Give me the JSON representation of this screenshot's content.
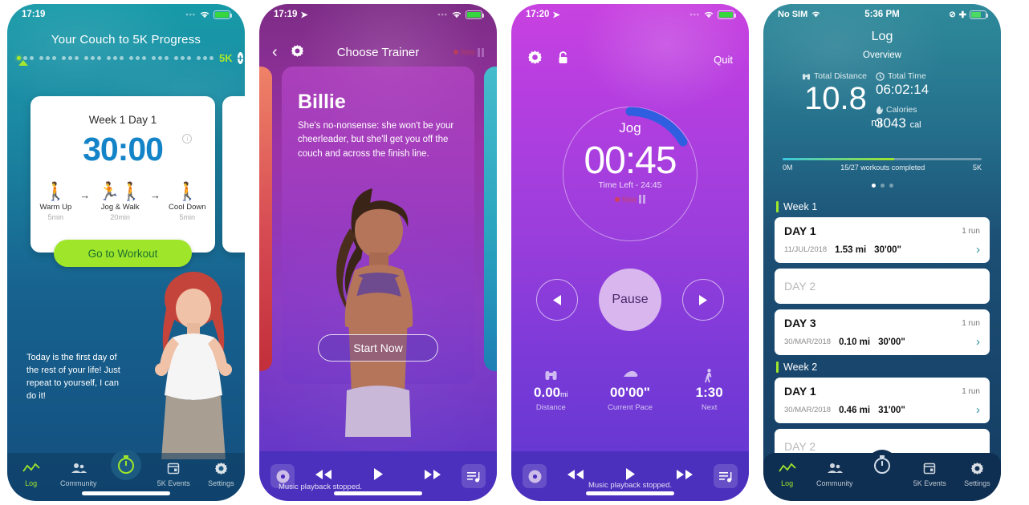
{
  "phone1": {
    "statusbar": {
      "time": "17:19",
      "wifi_icon": "wifi-icon",
      "battery_icon": "battery-charging-icon"
    },
    "title": "Your Couch to 5K Progress",
    "goal_label": "5K",
    "add_button": "+",
    "dot_groups": 9,
    "card": {
      "week_day": "Week 1 Day 1",
      "duration": "30:00",
      "info_icon": "i",
      "steps": [
        {
          "name": "Warm Up",
          "minutes": "5min",
          "icon": "walk-icon"
        },
        {
          "name": "Jog & Walk",
          "minutes": "20min",
          "icon": "run-walk-icon"
        },
        {
          "name": "Cool Down",
          "minutes": "5min",
          "icon": "cooldown-icon"
        }
      ],
      "arrow": "→",
      "cta": "Go to Workout"
    },
    "motivation": "Today is the first day of the rest of your life! Just repeat to yourself, I can do it!",
    "tabs": [
      {
        "label": "Log",
        "icon": "chart-line-icon"
      },
      {
        "label": "Community",
        "icon": "people-icon"
      },
      {
        "label": "",
        "icon": "stopwatch-icon"
      },
      {
        "label": "5K Events",
        "icon": "calendar-icon"
      },
      {
        "label": "Settings",
        "icon": "gear-icon"
      }
    ]
  },
  "phone2": {
    "statusbar": {
      "time": "17:19",
      "location_icon": "location-arrow-icon",
      "wifi_icon": "wifi-icon",
      "battery_icon": "battery-charging-icon"
    },
    "nav": {
      "back_icon": "chevron-left-icon",
      "settings_icon": "gear-icon",
      "title": "Choose Trainer",
      "recording_label": "Now"
    },
    "trainer": {
      "name": "Billie",
      "description": "She's no-nonsense: she won't be your cheerleader, but she'll get you off the couch and across the finish line."
    },
    "start_button": "Start Now",
    "music": {
      "status": "Music playback stopped.",
      "disc_icon": "disc-icon",
      "prev_icon": "rewind-icon",
      "play_icon": "play-icon",
      "next_icon": "fast-forward-icon",
      "playlist_icon": "playlist-icon"
    }
  },
  "phone3": {
    "statusbar": {
      "time": "17:20",
      "location_icon": "location-arrow-icon",
      "wifi_icon": "wifi-icon",
      "battery_icon": "battery-charging-icon"
    },
    "top": {
      "settings_icon": "gear-icon",
      "lock_icon": "lock-icon",
      "quit_label": "Quit"
    },
    "timer": {
      "phase": "Jog",
      "value": "00:45",
      "time_left": "Time Left - 24:45",
      "recording_label": "Now",
      "progress_percent": 28
    },
    "controls": {
      "prev_icon": "previous-icon",
      "pause_label": "Pause",
      "next_icon": "next-icon"
    },
    "stats": [
      {
        "icon": "binoculars-icon",
        "value": "0.00",
        "unit": "mi",
        "label": "Distance"
      },
      {
        "icon": "shoe-icon",
        "value": "00'00\"",
        "unit": "",
        "label": "Current Pace"
      },
      {
        "icon": "walk-icon",
        "value": "1:30",
        "unit": "",
        "label": "Next"
      }
    ],
    "music": {
      "status": "Music playback stopped.",
      "disc_icon": "disc-icon",
      "prev_icon": "rewind-icon",
      "play_icon": "play-icon",
      "next_icon": "fast-forward-icon",
      "playlist_icon": "playlist-icon"
    }
  },
  "phone4": {
    "statusbar": {
      "carrier": "No SIM",
      "time": "5:36 PM",
      "wifi_icon": "wifi-icon",
      "bluetooth_icon": "bluetooth-icon",
      "battery_icon": "battery-icon"
    },
    "title": "Log",
    "subtitle": "Overview",
    "summary": {
      "distance_label": "Total Distance",
      "distance_value": "10.8",
      "distance_unit": "mi",
      "time_label": "Total Time",
      "time_value": "06:02:14",
      "calories_label": "Calories",
      "calories_value": "3043",
      "calories_unit": "cal"
    },
    "progress": {
      "start": "0M",
      "middle": "15/27 workouts completed",
      "end": "5K",
      "percent": 56
    },
    "pager": {
      "total": 3,
      "active": 0
    },
    "weeks": [
      {
        "label": "Week 1",
        "days": [
          {
            "day": "DAY 1",
            "runs": "1 run",
            "date": "11/JUL/2018",
            "distance": "1.53 mi",
            "duration": "30'00\"",
            "empty": false
          },
          {
            "day": "DAY 2",
            "runs": "",
            "date": "",
            "distance": "",
            "duration": "",
            "empty": true
          },
          {
            "day": "DAY 3",
            "runs": "1 run",
            "date": "30/MAR/2018",
            "distance": "0.10 mi",
            "duration": "30'00\"",
            "empty": false
          }
        ]
      },
      {
        "label": "Week 2",
        "days": [
          {
            "day": "DAY 1",
            "runs": "1 run",
            "date": "30/MAR/2018",
            "distance": "0.46 mi",
            "duration": "31'00\"",
            "empty": false
          },
          {
            "day": "DAY 2",
            "runs": "",
            "date": "",
            "distance": "",
            "duration": "",
            "empty": true
          }
        ]
      }
    ],
    "tabs": [
      {
        "label": "Log",
        "icon": "chart-line-icon"
      },
      {
        "label": "Community",
        "icon": "people-icon"
      },
      {
        "label": "",
        "icon": "stopwatch-icon"
      },
      {
        "label": "5K Events",
        "icon": "calendar-icon"
      },
      {
        "label": "Settings",
        "icon": "gear-icon"
      }
    ]
  },
  "colors": {
    "accent_green": "#9fe62b",
    "teal": "#1b8ba4",
    "purple": "#9b33a8",
    "card_white": "#ffffff",
    "blue_timer": "#1484c8",
    "ring_progress": "#2f5fe0"
  }
}
